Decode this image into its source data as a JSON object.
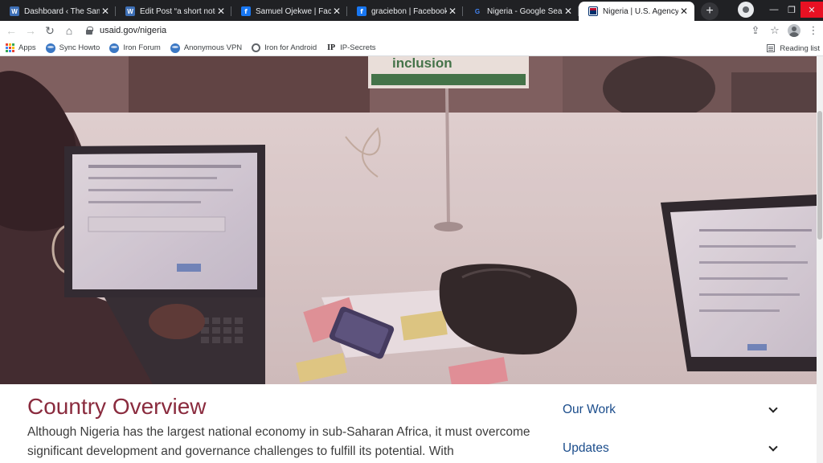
{
  "tabs": [
    {
      "title": "Dashboard ‹ The Samuel O",
      "favicon": "wordpress-icon",
      "active": false
    },
    {
      "title": "Edit Post “a short note to",
      "favicon": "wordpress-icon",
      "active": false
    },
    {
      "title": "Samuel Ojekwe | Facebook",
      "favicon": "facebook-icon",
      "active": false
    },
    {
      "title": "graciebon | Facebook",
      "favicon": "facebook-icon",
      "active": false
    },
    {
      "title": "Nigeria - Google Search",
      "favicon": "google-icon",
      "active": false
    },
    {
      "title": "Nigeria | U.S. Agency for In",
      "favicon": "usaid-icon",
      "active": true
    }
  ],
  "address_bar": {
    "url": "usaid.gov/nigeria"
  },
  "bookmarks": [
    {
      "label": "Apps",
      "icon": "apps-grid-icon"
    },
    {
      "label": "Sync Howto",
      "icon": "globe-icon"
    },
    {
      "label": "Iron Forum",
      "icon": "globe-icon"
    },
    {
      "label": "Anonymous VPN",
      "icon": "globe-icon"
    },
    {
      "label": "Iron for Android",
      "icon": "web-globe-icon"
    },
    {
      "label": "IP-Secrets",
      "icon": "ip-icon"
    }
  ],
  "reading_list": "Reading list",
  "hero": {
    "sign_text": "inclusion"
  },
  "main": {
    "title": "Country Overview",
    "text": "Although Nigeria has the largest national economy in sub-Saharan Africa, it must overcome significant development and governance challenges to fulfill its potential. With"
  },
  "side_nav": [
    {
      "label": "Our Work"
    },
    {
      "label": "Updates"
    }
  ],
  "colors": {
    "heading": "#8a2b3e",
    "link": "#1a4c8b",
    "tab_strip": "#202124"
  }
}
